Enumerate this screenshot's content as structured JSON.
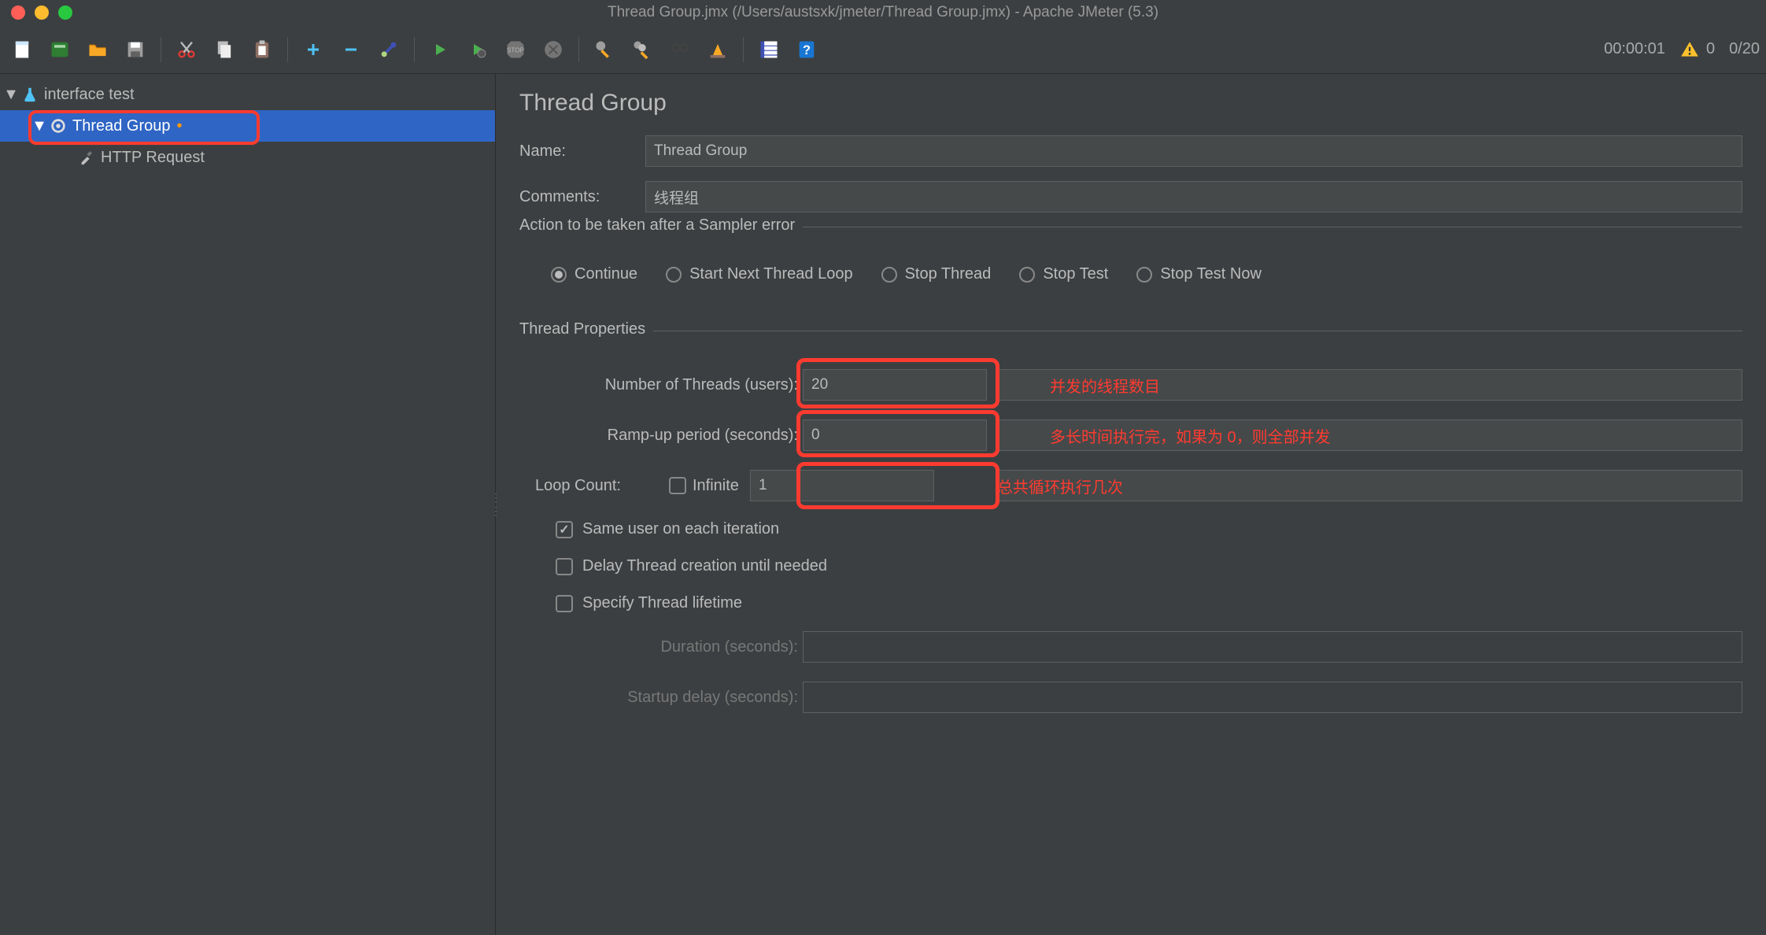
{
  "titlebar": {
    "title": "Thread Group.jmx (/Users/austsxk/jmeter/Thread Group.jmx) - Apache JMeter (5.3)"
  },
  "toolbar_right": {
    "timer": "00:00:01",
    "warn_count": "0",
    "threads": "0/20"
  },
  "tree": {
    "root_label": "interface test",
    "thread_group": "Thread Group",
    "http_request": "HTTP Request"
  },
  "panel": {
    "heading": "Thread Group",
    "name_label": "Name:",
    "name_value": "Thread Group",
    "comments_label": "Comments:",
    "comments_value": "线程组",
    "sampler_error_legend": "Action to be taken after a Sampler error",
    "radios": {
      "continue": "Continue",
      "start_next": "Start Next Thread Loop",
      "stop_thread": "Stop Thread",
      "stop_test": "Stop Test",
      "stop_test_now": "Stop Test Now"
    },
    "thread_props_legend": "Thread Properties",
    "num_threads_label": "Number of Threads (users):",
    "num_threads_value": "20",
    "rampup_label": "Ramp-up period (seconds):",
    "rampup_value": "0",
    "loop_count_label": "Loop Count:",
    "infinite_label": "Infinite",
    "loop_count_value": "1",
    "same_user_label": "Same user on each iteration",
    "delay_creation_label": "Delay Thread creation until needed",
    "specify_lifetime_label": "Specify Thread lifetime",
    "duration_label": "Duration (seconds):",
    "startup_delay_label": "Startup delay (seconds):"
  },
  "annotations": {
    "num_threads": "并发的线程数目",
    "rampup": "多长时间执行完，如果为 0，则全部并发",
    "loop_count": "总共循环执行几次"
  }
}
